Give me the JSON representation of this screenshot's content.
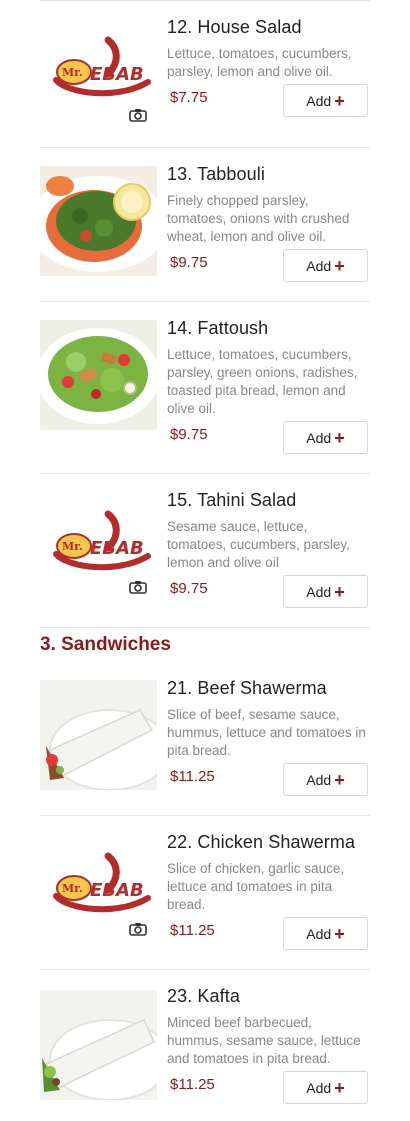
{
  "colors": {
    "accent": "#8b1a1a",
    "text": "#222222",
    "muted": "#888888",
    "divider": "#e6e6e6"
  },
  "logo_text": "Mr. KEBAB",
  "sections": [
    {
      "items": [
        {
          "title": "12. House Salad",
          "description": "Lettuce, tomatoes, cucumbers, parsley, lemon and olive oil.",
          "price": "$7.75",
          "add_label": "Add",
          "image": "placeholder-logo"
        },
        {
          "title": "13. Tabbouli",
          "description": "Finely chopped parsley, tomatoes, onions with crushed wheat, lemon and olive oil.",
          "price": "$9.75",
          "add_label": "Add",
          "image": "tabbouli-photo"
        },
        {
          "title": "14. Fattoush",
          "description": "Lettuce, tomatoes, cucumbers, parsley, green onions, radishes, toasted pita bread, lemon and olive oil.",
          "price": "$9.75",
          "add_label": "Add",
          "image": "fattoush-photo"
        },
        {
          "title": "15. Tahini Salad",
          "description": "Sesame sauce, lettuce, tomatoes, cucumbers, parsley, lemon and olive oil",
          "price": "$9.75",
          "add_label": "Add",
          "image": "placeholder-logo"
        }
      ]
    },
    {
      "title": "3. Sandwiches",
      "items": [
        {
          "title": "21. Beef Shawerma",
          "description": "Slice of beef, sesame sauce, hummus, lettuce and tomatoes in pita bread.",
          "price": "$11.25",
          "add_label": "Add",
          "image": "beef-shawerma-photo"
        },
        {
          "title": "22. Chicken Shawerma",
          "description": "Slice of chicken, garlic sauce, lettuce and tomatoes in pita bread.",
          "price": "$11.25",
          "add_label": "Add",
          "image": "placeholder-logo"
        },
        {
          "title": "23. Kafta",
          "description": "Minced beef barbecued, hummus, sesame sauce, lettuce and tomatoes in pita bread.",
          "price": "$11.25",
          "add_label": "Add",
          "image": "kafta-photo"
        }
      ]
    }
  ]
}
